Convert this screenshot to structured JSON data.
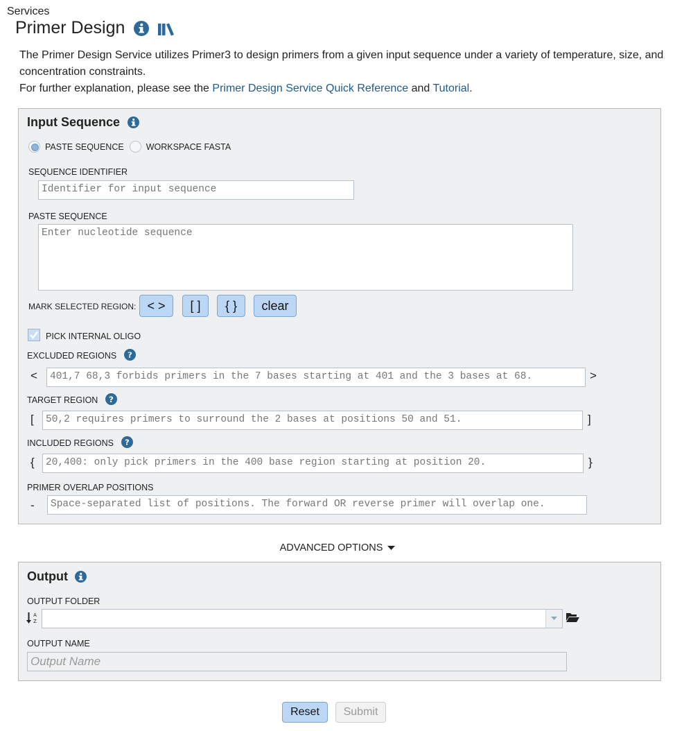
{
  "breadcrumb": "Services",
  "page_title": "Primer Design",
  "description": {
    "line1": "The Primer Design Service utilizes Primer3 to design primers from a given input sequence under a variety of temperature, size, and concentration constraints.",
    "line2_prefix": "For further explanation, please see the ",
    "quick_ref_link": "Primer Design Service Quick Reference",
    "and_text": " and ",
    "tutorial_link": "Tutorial",
    "line2_suffix": "."
  },
  "input_sequence": {
    "title": "Input Sequence",
    "radio_paste": "PASTE SEQUENCE",
    "radio_workspace": "WORKSPACE FASTA",
    "selected_source": "PASTE SEQUENCE",
    "sequence_identifier_label": "SEQUENCE IDENTIFIER",
    "sequence_identifier_placeholder": "Identifier for input sequence",
    "paste_sequence_label": "PASTE SEQUENCE",
    "paste_sequence_placeholder": "Enter nucleotide sequence",
    "mark_selected_region_label": "MARK SELECTED REGION:",
    "mark_buttons": [
      "< >",
      "[ ]",
      "{ }",
      "clear"
    ],
    "pick_internal_oligo_label": "PICK INTERNAL OLIGO",
    "pick_internal_oligo_checked": true,
    "excluded_regions_label": "EXCLUDED REGIONS",
    "excluded_regions_open": "<",
    "excluded_regions_close": ">",
    "excluded_regions_placeholder": "401,7 68,3 forbids primers in the 7 bases starting at 401 and the 3 bases at 68.",
    "target_region_label": "TARGET REGION",
    "target_region_open": "[",
    "target_region_close": "]",
    "target_region_placeholder": "50,2 requires primers to surround the 2 bases at positions 50 and 51.",
    "included_regions_label": "INCLUDED REGIONS",
    "included_regions_open": "{",
    "included_regions_close": "}",
    "included_regions_placeholder": "20,400: only pick primers in the 400 base region starting at position 20.",
    "overlap_label": "PRIMER OVERLAP POSITIONS",
    "overlap_prefix": "-",
    "overlap_placeholder": "Space-separated list of positions. The forward OR reverse primer will overlap one."
  },
  "advanced_options_label": "ADVANCED OPTIONS",
  "output": {
    "title": "Output",
    "folder_label": "OUTPUT FOLDER",
    "folder_value": "",
    "name_label": "OUTPUT NAME",
    "name_placeholder": "Output Name"
  },
  "buttons": {
    "reset": "Reset",
    "submit": "Submit"
  },
  "colors": {
    "accent": "#2e6a99",
    "link": "#1e5a8c",
    "button_blue": "#bcd7f5",
    "panel_bg": "#eff0f2"
  }
}
